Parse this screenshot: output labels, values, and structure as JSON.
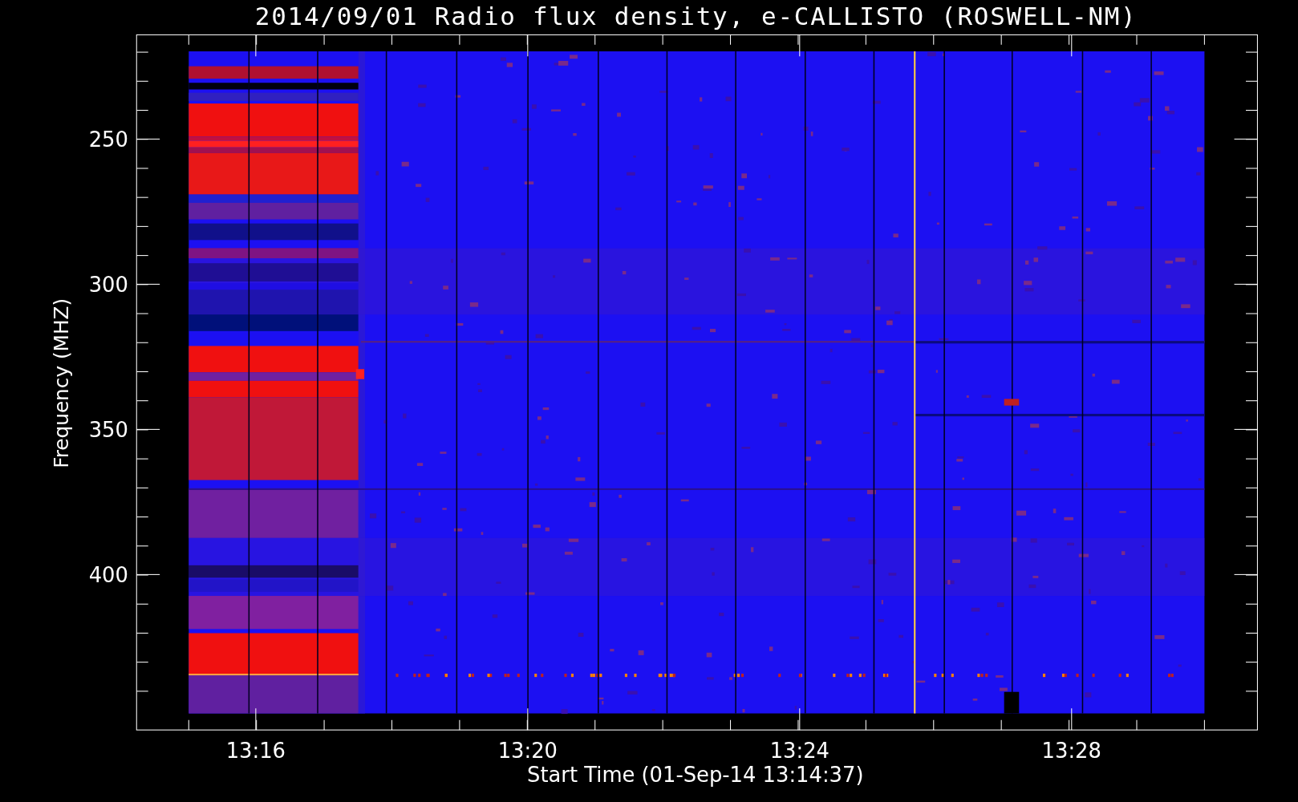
{
  "plot": {
    "title": "2014/09/01  Radio flux density, e-CALLISTO (ROSWELL-NM)",
    "ylabel": "Frequency (MHZ)",
    "xlabel": "Start Time (01-Sep-14 13:14:37)",
    "yticks": [
      "250",
      "300",
      "350",
      "400"
    ],
    "xticks": [
      "13:16",
      "13:20",
      "13:24",
      "13:28"
    ]
  }
}
